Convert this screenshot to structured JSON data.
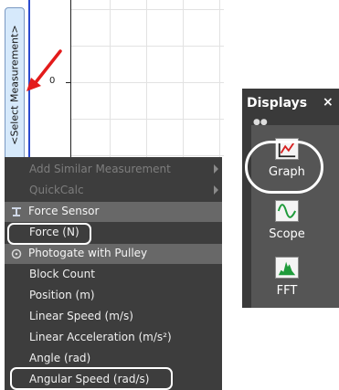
{
  "graph": {
    "select_measurement_label": "<Select Measurement>",
    "y_zero_label": "0"
  },
  "menu": {
    "items": [
      {
        "label": "Add Similar Measurement",
        "state": "disabled",
        "submenu": true
      },
      {
        "label": "QuickCalc",
        "state": "disabled",
        "submenu": true
      },
      {
        "label": "Force Sensor",
        "state": "header",
        "icon": "force-sensor-icon"
      },
      {
        "label": "Force (N)",
        "state": "enabled",
        "highlighted": true
      },
      {
        "label": "Photogate with Pulley",
        "state": "header",
        "icon": "photogate-icon"
      },
      {
        "label": "Block Count",
        "state": "enabled"
      },
      {
        "label": "Position (m)",
        "state": "enabled"
      },
      {
        "label": "Linear Speed (m/s)",
        "state": "enabled"
      },
      {
        "label": "Linear Acceleration (m/s²)",
        "state": "enabled"
      },
      {
        "label": "Angle (rad)",
        "state": "enabled"
      },
      {
        "label": "Angular Speed (rad/s)",
        "state": "enabled",
        "highlighted": true
      }
    ]
  },
  "displays": {
    "title": "Displays",
    "close_symbol": "×",
    "handle_symbol": "●●",
    "items": [
      {
        "label": "Graph",
        "icon": "graph-icon",
        "highlighted": true
      },
      {
        "label": "Scope",
        "icon": "scope-icon"
      },
      {
        "label": "FFT",
        "icon": "fft-icon"
      }
    ]
  },
  "colors": {
    "menu_bg": "#3d3d3d",
    "menu_header": "#686868",
    "panel_bg": "#3a3a3a",
    "annotation_arrow": "#e31b1b",
    "highlight_ring": "#ffffff",
    "measurement_tab": "#d6e9fb"
  }
}
